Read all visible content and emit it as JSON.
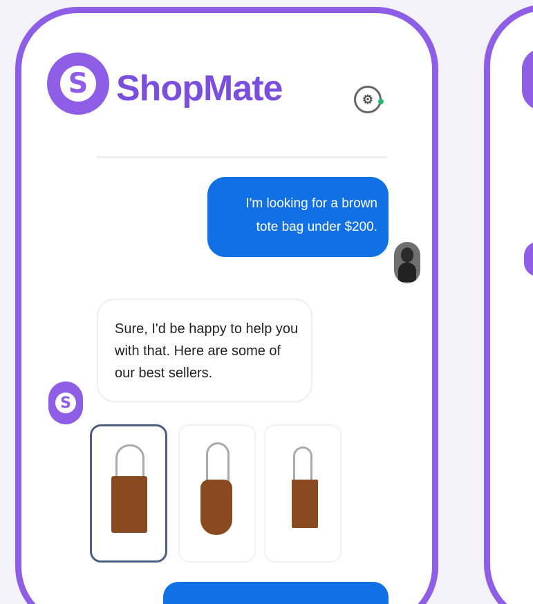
{
  "app": {
    "brand_name": "ShopMate",
    "logo_letter": "S",
    "brand_color": "#8f5ee6",
    "accent_color": "#1170e4"
  },
  "header": {
    "settings_icon": "settings-icon",
    "settings_glyph": "⚙"
  },
  "chat": {
    "user_message": "I'm looking for a brown tote bag under $200.",
    "bot_message": "Sure, I'd be happy to help you with that. Here are some of our best sellers.",
    "bot_avatar_letter": "S"
  },
  "products": [
    {
      "selected": true,
      "icon": "tote-bag-icon"
    },
    {
      "selected": false,
      "icon": "tote-bag-icon"
    },
    {
      "selected": false,
      "icon": "tote-bag-icon"
    }
  ]
}
